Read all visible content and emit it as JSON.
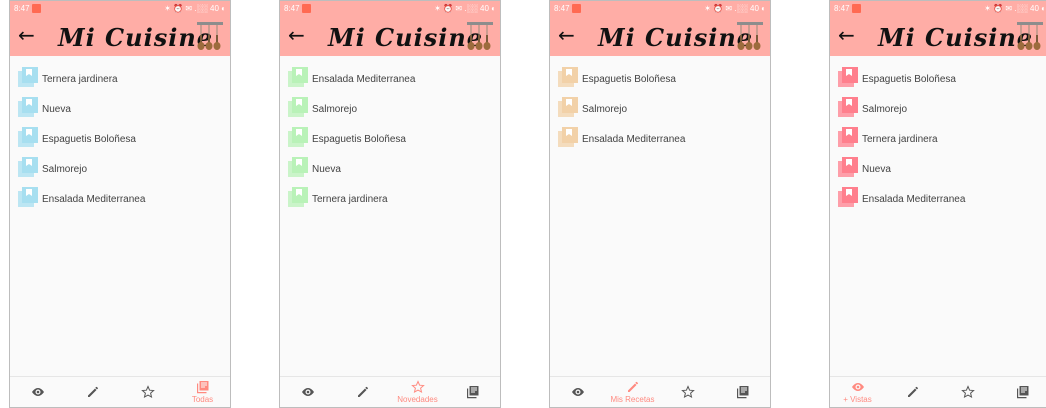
{
  "app": {
    "title": "Mi Cuisine"
  },
  "status": {
    "time": "8:47",
    "sys": "✶ ⏰ ✉ .░░ 40 ◐"
  },
  "colors": {
    "appbar": "#ffada6",
    "accent": "#ff8a80",
    "screen1_icon": "#a7dff0",
    "screen2_icon": "#b9f2b8",
    "screen3_icon": "#f2d1a8",
    "screen4_icon": "#ff7f8d"
  },
  "icons": {
    "back": "arrow-left-icon",
    "logo": "wooden-spoons-icon",
    "recipe": "book-icon",
    "vistas": "eye-icon",
    "mis_recetas": "pencil-icon",
    "novedades": "star-icon",
    "todas": "library-books-icon"
  },
  "screens": [
    {
      "active_tab": "Todas",
      "items": [
        "Ternera jardinera",
        "Nueva",
        "Espaguetis Boloñesa",
        "Salmorejo",
        "Ensalada Mediterranea"
      ],
      "tabs": {
        "vistas": "",
        "mis_recetas": "",
        "novedades": "",
        "todas": "Todas"
      }
    },
    {
      "active_tab": "Novedades",
      "items": [
        "Ensalada Mediterranea",
        "Salmorejo",
        "Espaguetis Boloñesa",
        "Nueva",
        "Ternera jardinera"
      ],
      "tabs": {
        "vistas": "",
        "mis_recetas": "",
        "novedades": "Novedades",
        "todas": ""
      }
    },
    {
      "active_tab": "Mis Recetas",
      "items": [
        "Espaguetis Boloñesa",
        "Salmorejo",
        "Ensalada Mediterranea"
      ],
      "tabs": {
        "vistas": "",
        "mis_recetas": "Mis Recetas",
        "novedades": "",
        "todas": ""
      }
    },
    {
      "active_tab": "+ Vistas",
      "items": [
        "Espaguetis Boloñesa",
        "Salmorejo",
        "Ternera jardinera",
        "Nueva",
        "Ensalada Mediterranea"
      ],
      "tabs": {
        "vistas": "+ Vistas",
        "mis_recetas": "",
        "novedades": "",
        "todas": ""
      }
    }
  ]
}
